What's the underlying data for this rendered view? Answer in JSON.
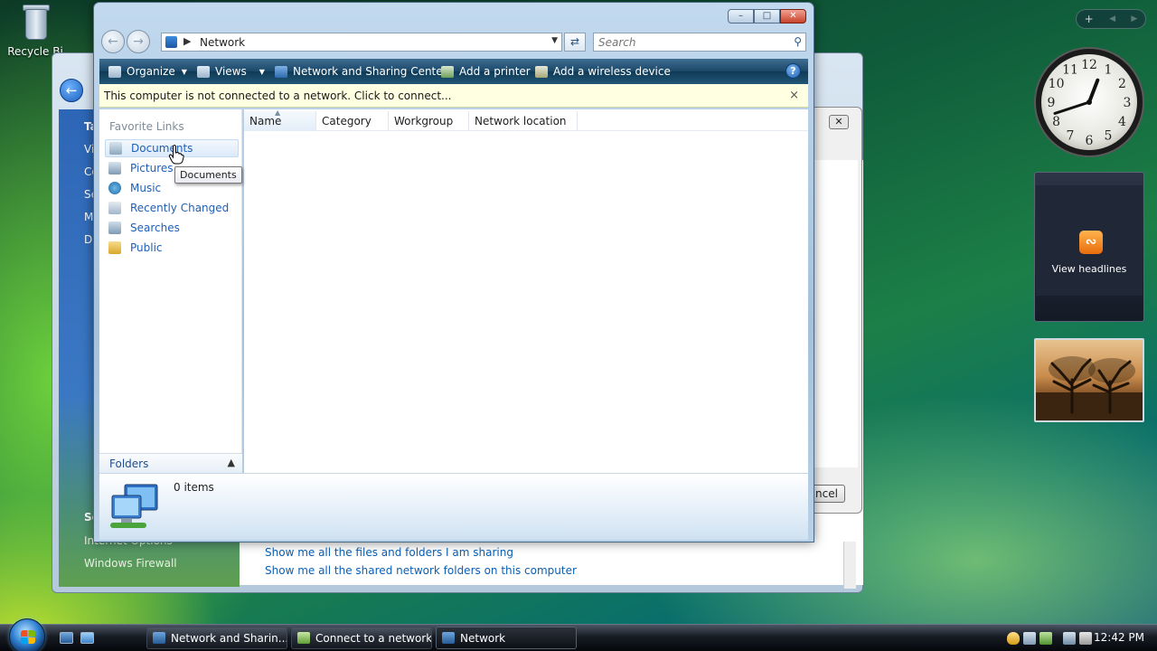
{
  "desktop": {
    "recycle_bin_label": "Recycle Bi"
  },
  "back_window": {
    "left_pane_items": [
      "Ta",
      "Vi",
      "Co",
      "Se",
      "M",
      "Di"
    ],
    "see_also_items": [
      "Se",
      "Internet Options",
      "Windows Firewall"
    ],
    "links": [
      "Show me all the files and folders I am sharing",
      "Show me all the shared network folders on this computer"
    ],
    "dialog_cancel_label": "ncel"
  },
  "window": {
    "title": "Network",
    "address": {
      "location": "Network"
    },
    "search": {
      "placeholder": "Search"
    },
    "toolbar": {
      "organize": "Organize",
      "views": "Views",
      "network_sharing_center": "Network and Sharing Center",
      "add_printer": "Add a printer",
      "add_wireless_device": "Add a wireless device",
      "help": "?"
    },
    "infobar": {
      "message": "This computer is not connected to a network. Click to connect...",
      "close": "×"
    },
    "nav_pane": {
      "header": "Favorite Links",
      "links": [
        "Documents",
        "Pictures",
        "Music",
        "Recently Changed",
        "Searches",
        "Public"
      ],
      "folders_label": "Folders"
    },
    "columns": [
      "Name",
      "Category",
      "Workgroup",
      "Network location"
    ],
    "details": {
      "item_count": "0 items"
    },
    "tooltip": "Documents"
  },
  "gadgets": {
    "feed_label": "View headlines",
    "add_gadget": "+",
    "clock": {
      "hour": 12,
      "minute": 42
    }
  },
  "taskbar": {
    "buttons": [
      "Network and Sharin...",
      "Connect to a network",
      "Network"
    ],
    "time": "12:42 PM"
  },
  "colors": {
    "link_blue": "#1e5fb8",
    "infobar_bg": "#ffffe1",
    "toolbar_dark": "#1b4767"
  }
}
